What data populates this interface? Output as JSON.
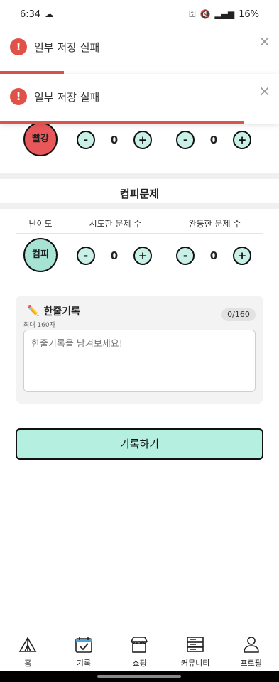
{
  "status": {
    "time": "6:34",
    "battery": "16%"
  },
  "toasts": [
    {
      "message": "일부 저장 실패",
      "close": "×"
    },
    {
      "message": "일부 저장 실패",
      "close": "×"
    }
  ],
  "red_row": {
    "badge": "빨강",
    "attempted": "0",
    "completed": "0"
  },
  "section": {
    "title": "컴피문제",
    "columns": [
      "난이도",
      "시도한 문제 수",
      "완등한 문제 수"
    ],
    "badge": "컴피",
    "attempted": "0",
    "completed": "0"
  },
  "steppers": {
    "minus": "-",
    "plus": "+"
  },
  "memo": {
    "title": "한줄기록",
    "subtitle": "최대 160자",
    "counter": "0/160",
    "placeholder": "한줄기록을 남겨보세요!"
  },
  "submit_label": "기록하기",
  "tabs": [
    {
      "label": "홈",
      "icon": "tent-icon"
    },
    {
      "label": "기록",
      "icon": "calendar-check-icon"
    },
    {
      "label": "쇼핑",
      "icon": "store-icon"
    },
    {
      "label": "커뮤니티",
      "icon": "server-icon"
    },
    {
      "label": "프로필",
      "icon": "person-icon"
    }
  ],
  "colors": {
    "accent": "#b4efdf",
    "error": "#e05248",
    "red_badge": "#e8585a",
    "compi_badge": "#a6e3d3"
  }
}
